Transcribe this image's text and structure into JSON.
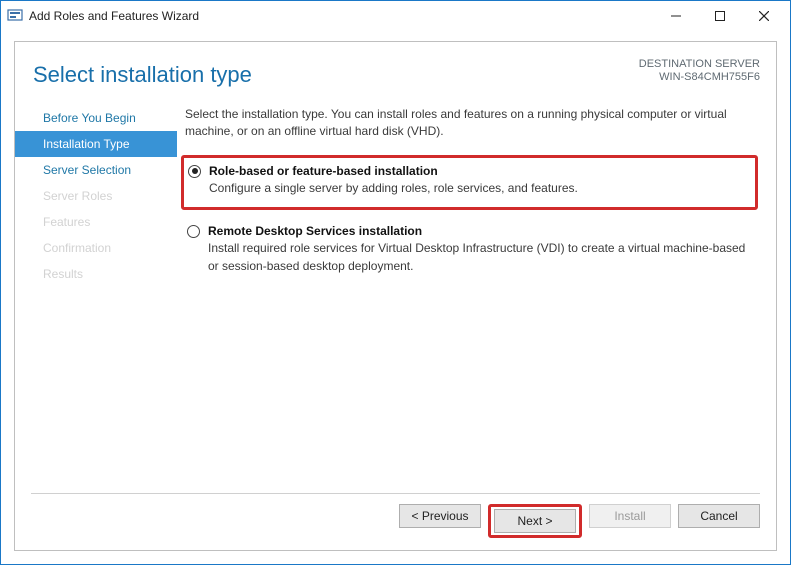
{
  "titlebar": {
    "title": "Add Roles and Features Wizard"
  },
  "header": {
    "page_title": "Select installation type",
    "server_label": "DESTINATION SERVER",
    "server_name": "WIN-S84CMH755F6"
  },
  "sidebar": {
    "items": [
      {
        "label": "Before You Begin",
        "state": "normal"
      },
      {
        "label": "Installation Type",
        "state": "active"
      },
      {
        "label": "Server Selection",
        "state": "normal"
      },
      {
        "label": "Server Roles",
        "state": "disabled"
      },
      {
        "label": "Features",
        "state": "disabled"
      },
      {
        "label": "Confirmation",
        "state": "disabled"
      },
      {
        "label": "Results",
        "state": "disabled"
      }
    ]
  },
  "main": {
    "intro": "Select the installation type. You can install roles and features on a running physical computer or virtual machine, or on an offline virtual hard disk (VHD).",
    "options": [
      {
        "title": "Role-based or feature-based installation",
        "desc": "Configure a single server by adding roles, role services, and features.",
        "selected": true,
        "highlight": true
      },
      {
        "title": "Remote Desktop Services installation",
        "desc": "Install required role services for Virtual Desktop Infrastructure (VDI) to create a virtual machine-based or session-based desktop deployment.",
        "selected": false,
        "highlight": false
      }
    ]
  },
  "footer": {
    "previous": "< Previous",
    "next": "Next >",
    "install": "Install",
    "cancel": "Cancel"
  }
}
